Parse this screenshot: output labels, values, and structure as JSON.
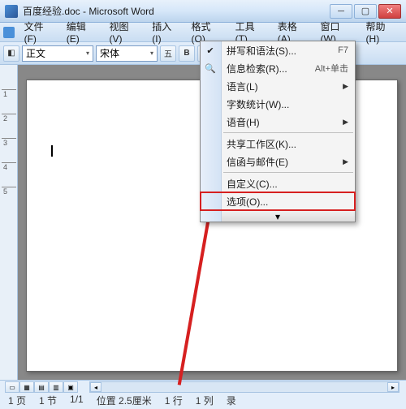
{
  "title": "百度经验.doc - Microsoft Word",
  "menubar": [
    "文件(F)",
    "编辑(E)",
    "视图(V)",
    "插入(I)",
    "格式(O)",
    "工具(T)",
    "表格(A)",
    "窗口(W)",
    "帮助(H)"
  ],
  "toolbar": {
    "style_label": "正文",
    "font_label": "宋体"
  },
  "tools_menu": {
    "items": [
      {
        "label": "拼写和语法(S)...",
        "shortcut": "F7",
        "icon": "✔"
      },
      {
        "label": "信息检索(R)...",
        "shortcut": "Alt+单击",
        "icon": "🔍"
      },
      {
        "label": "语言(L)",
        "submenu": true
      },
      {
        "label": "字数统计(W)..."
      },
      {
        "label": "语音(H)",
        "submenu": true
      },
      {
        "sep": true
      },
      {
        "label": "共享工作区(K)..."
      },
      {
        "label": "信函与邮件(E)",
        "submenu": true
      },
      {
        "sep": true
      },
      {
        "label": "自定义(C)..."
      },
      {
        "label": "选项(O)...",
        "highlighted": true
      }
    ],
    "expand": "▾"
  },
  "status": {
    "page": "1 页",
    "section": "1 节",
    "pageof": "1/1",
    "position": "位置 2.5厘米",
    "line": "1 行",
    "column": "1 列",
    "mode": "录"
  }
}
